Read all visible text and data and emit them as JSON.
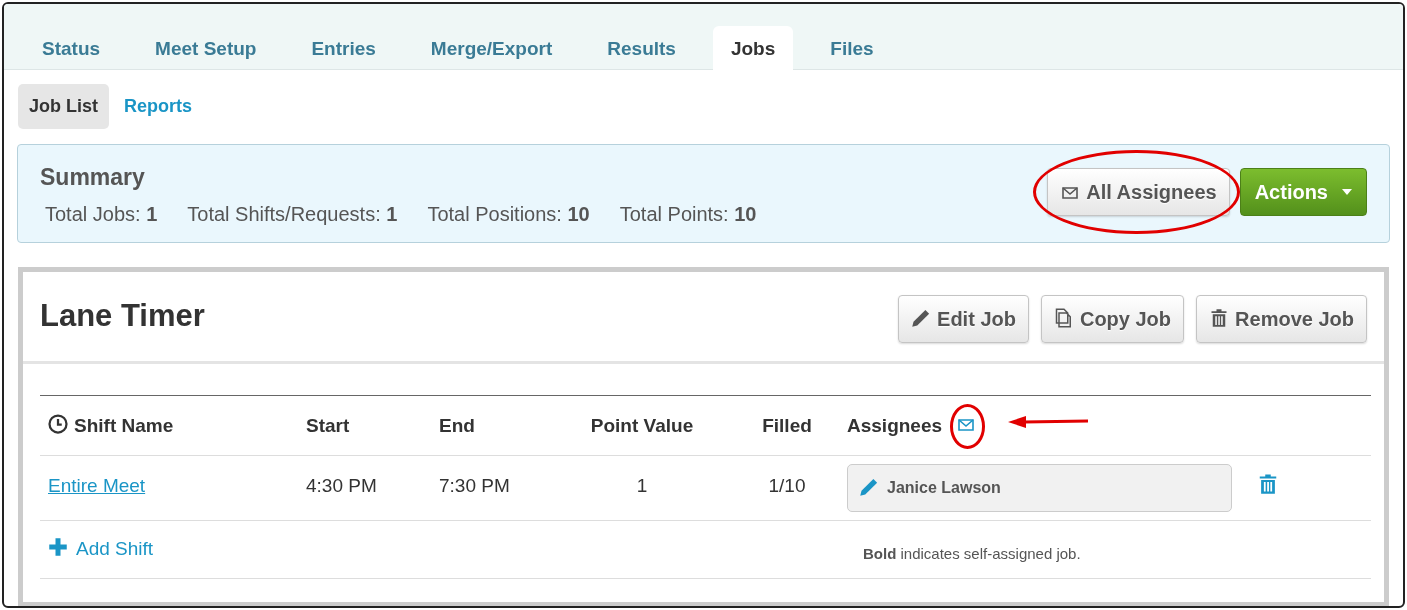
{
  "tabs": [
    {
      "label": "Status",
      "selected": false
    },
    {
      "label": "Meet Setup",
      "selected": false
    },
    {
      "label": "Entries",
      "selected": false
    },
    {
      "label": "Merge/Export",
      "selected": false
    },
    {
      "label": "Results",
      "selected": false
    },
    {
      "label": "Jobs",
      "selected": true
    },
    {
      "label": "Files",
      "selected": false
    }
  ],
  "subtabs": [
    {
      "label": "Job List",
      "selected": true
    },
    {
      "label": "Reports",
      "selected": false
    }
  ],
  "summary": {
    "title": "Summary",
    "stats": [
      {
        "label": "Total Jobs:",
        "value": "1"
      },
      {
        "label": "Total Shifts/Requests:",
        "value": "1"
      },
      {
        "label": "Total Positions:",
        "value": "10"
      },
      {
        "label": "Total Points:",
        "value": "10"
      }
    ],
    "email_button": {
      "label": "All Assignees",
      "circled": true
    },
    "actions_button": "Actions"
  },
  "job": {
    "title": "Lane Timer",
    "buttons": [
      {
        "kind": "edit",
        "label": "Edit Job"
      },
      {
        "kind": "copy",
        "label": "Copy Job"
      },
      {
        "kind": "remove",
        "label": "Remove Job"
      }
    ],
    "columns": [
      "Shift Name",
      "Start",
      "End",
      "Point Value",
      "Filled",
      "Assignees"
    ],
    "assignees_email_icon": {
      "circled": true,
      "arrow": true
    },
    "rows": [
      {
        "shift_name": "Entire Meet",
        "start": "4:30 PM",
        "end": "7:30 PM",
        "point_value": "1",
        "filled": "1/10",
        "assignees": [
          "Janice Lawson"
        ]
      }
    ],
    "add_shift": "Add Shift",
    "note": "**Bold** indicates self-assigned job."
  }
}
